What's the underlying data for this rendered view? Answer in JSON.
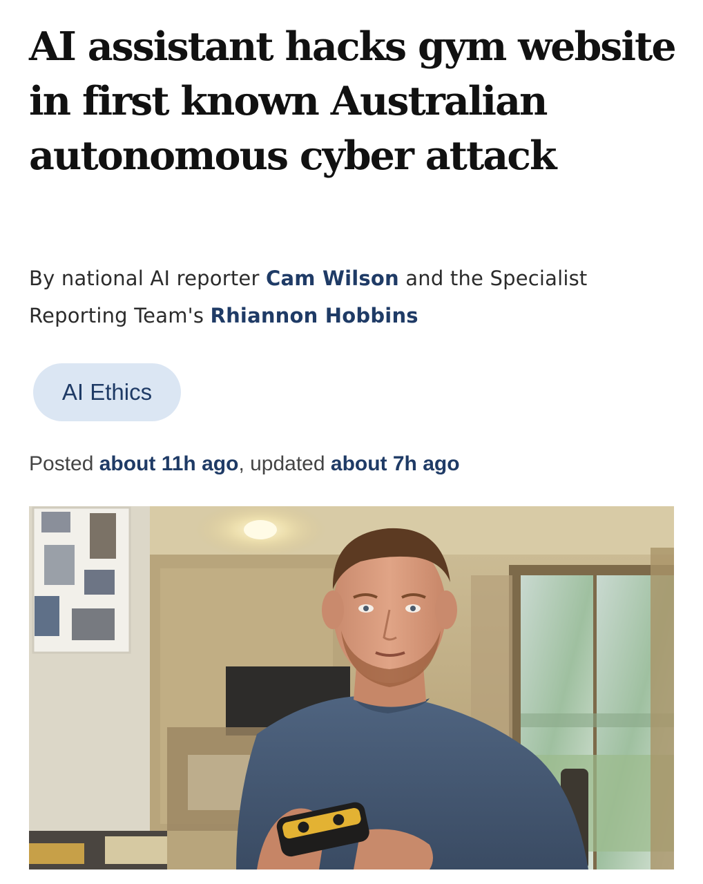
{
  "article": {
    "headline": "AI assistant hacks gym website in first known Australian autonomous cyber attack",
    "byline": {
      "prefix": "By national AI reporter ",
      "author1": "Cam Wilson",
      "middle": " and the Specialist Reporting Team's ",
      "author2": "Rhiannon Hobbins"
    },
    "tag": "AI Ethics",
    "timestamps": {
      "posted_label": "Posted ",
      "posted_value": "about 11h ago",
      "separator": ", updated ",
      "updated_value": "about 7h ago"
    },
    "image": {
      "subject": "man-holding-phone-photo"
    },
    "colors": {
      "author_link": "#1f3b66",
      "tag_background": "#dbe6f3",
      "headline": "#111111"
    }
  }
}
